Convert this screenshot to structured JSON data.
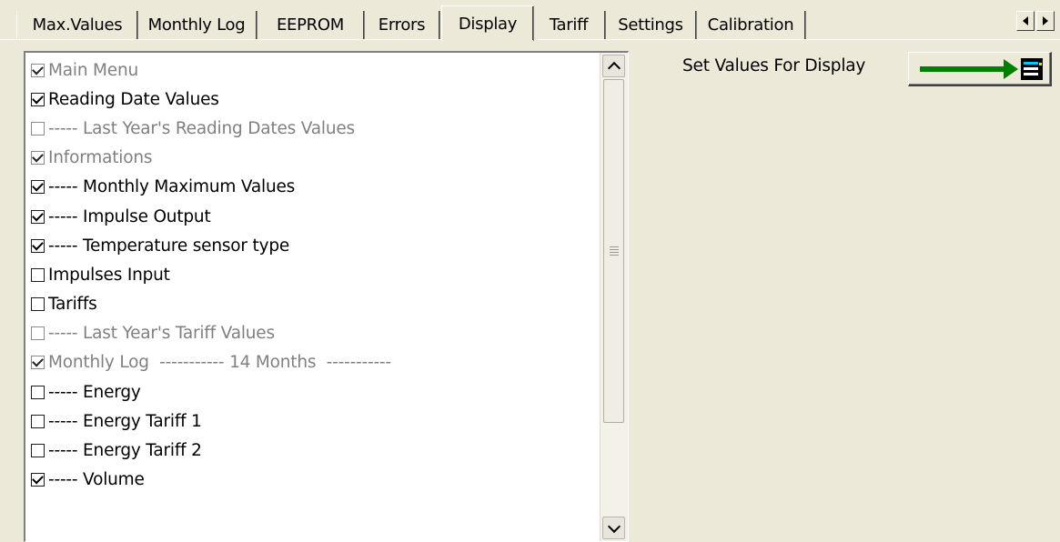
{
  "tabs": [
    {
      "label": "Max.Values"
    },
    {
      "label": "Monthly Log"
    },
    {
      "label": "EEPROM"
    },
    {
      "label": "Errors"
    },
    {
      "label": "Display",
      "active": true
    },
    {
      "label": "Tariff"
    },
    {
      "label": "Settings"
    },
    {
      "label": "Calibration"
    }
  ],
  "tab_scroll": {
    "left_icon": "arrow-left-icon",
    "right_icon": "arrow-right-icon"
  },
  "display_list": {
    "items": [
      {
        "label": "Main Menu",
        "checked": true,
        "enabled": false
      },
      {
        "label": "Reading Date Values",
        "checked": true,
        "enabled": true
      },
      {
        "label": "----- Last Year's Reading Dates Values",
        "checked": false,
        "enabled": false
      },
      {
        "label": "Informations",
        "checked": true,
        "enabled": false
      },
      {
        "label": "----- Monthly Maximum Values",
        "checked": true,
        "enabled": true
      },
      {
        "label": "----- Impulse Output",
        "checked": true,
        "enabled": true
      },
      {
        "label": "----- Temperature sensor type",
        "checked": true,
        "enabled": true
      },
      {
        "label": "Impulses Input",
        "checked": false,
        "enabled": true
      },
      {
        "label": "Tariffs",
        "checked": false,
        "enabled": true
      },
      {
        "label": "----- Last Year's Tariff Values",
        "checked": false,
        "enabled": false
      },
      {
        "label": "Monthly Log  ----------- 14 Months  -----------",
        "checked": true,
        "enabled": false
      },
      {
        "label": "----- Energy",
        "checked": false,
        "enabled": true
      },
      {
        "label": "----- Energy Tariff 1",
        "checked": false,
        "enabled": true
      },
      {
        "label": "----- Energy Tariff 2",
        "checked": false,
        "enabled": true
      },
      {
        "label": "----- Volume",
        "checked": true,
        "enabled": true
      }
    ]
  },
  "set_values": {
    "label": "Set Values For Display",
    "button_icon": "send-to-display-icon",
    "arrow_color": "#008000"
  }
}
